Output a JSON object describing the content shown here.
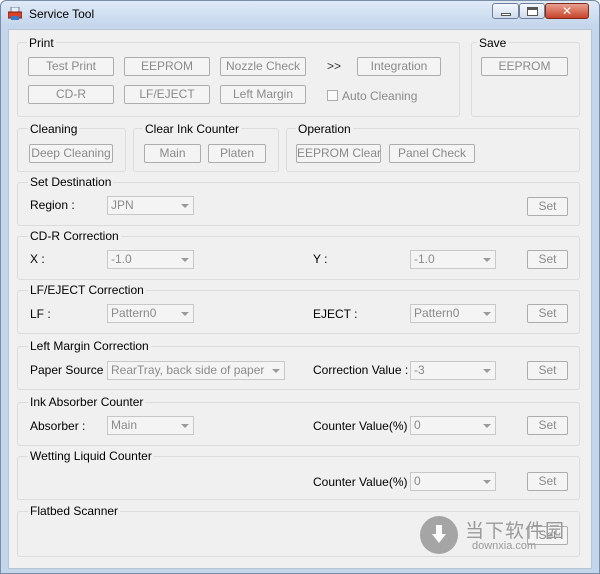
{
  "window": {
    "title": "Service Tool"
  },
  "print": {
    "label": "Print",
    "test_print": "Test Print",
    "eeprom": "EEPROM",
    "nozzle_check": "Nozzle Check",
    "more": ">>",
    "integration": "Integration",
    "cd_r": "CD-R",
    "lf_eject": "LF/EJECT",
    "left_margin": "Left Margin",
    "auto_cleaning": "Auto Cleaning"
  },
  "save": {
    "label": "Save",
    "eeprom": "EEPROM"
  },
  "cleaning": {
    "label": "Cleaning",
    "deep_cleaning": "Deep Cleaning"
  },
  "clear_ink": {
    "label": "Clear Ink Counter",
    "main": "Main",
    "platen": "Platen"
  },
  "operation": {
    "label": "Operation",
    "eeprom_clear": "EEPROM Clear",
    "panel_check": "Panel Check"
  },
  "set_destination": {
    "label": "Set Destination",
    "region_label": "Region :",
    "region_value": "JPN",
    "set": "Set"
  },
  "cdr_correction": {
    "label": "CD-R Correction",
    "x_label": "X :",
    "x_value": "-1.0",
    "y_label": "Y :",
    "y_value": "-1.0",
    "set": "Set"
  },
  "lf_eject_correction": {
    "label": "LF/EJECT Correction",
    "lf_label": "LF :",
    "lf_value": "Pattern0",
    "eject_label": "EJECT :",
    "eject_value": "Pattern0",
    "set": "Set"
  },
  "left_margin_correction": {
    "label": "Left Margin Correction",
    "source_label": "Paper Source :",
    "source_value": "RearTray, back side of paper",
    "corr_label": "Correction Value :",
    "corr_value": "-3",
    "set": "Set"
  },
  "ink_absorber": {
    "label": "Ink Absorber Counter",
    "absorber_label": "Absorber :",
    "absorber_value": "Main",
    "counter_label": "Counter Value(%) :",
    "counter_value": "0",
    "set": "Set"
  },
  "wetting_liquid": {
    "label": "Wetting Liquid Counter",
    "counter_label": "Counter Value(%) :",
    "counter_value": "0",
    "set": "Set"
  },
  "flatbed": {
    "label": "Flatbed Scanner",
    "set": "Set"
  },
  "watermark": {
    "cn_text": "当下软件园",
    "url": "downxia.com"
  }
}
